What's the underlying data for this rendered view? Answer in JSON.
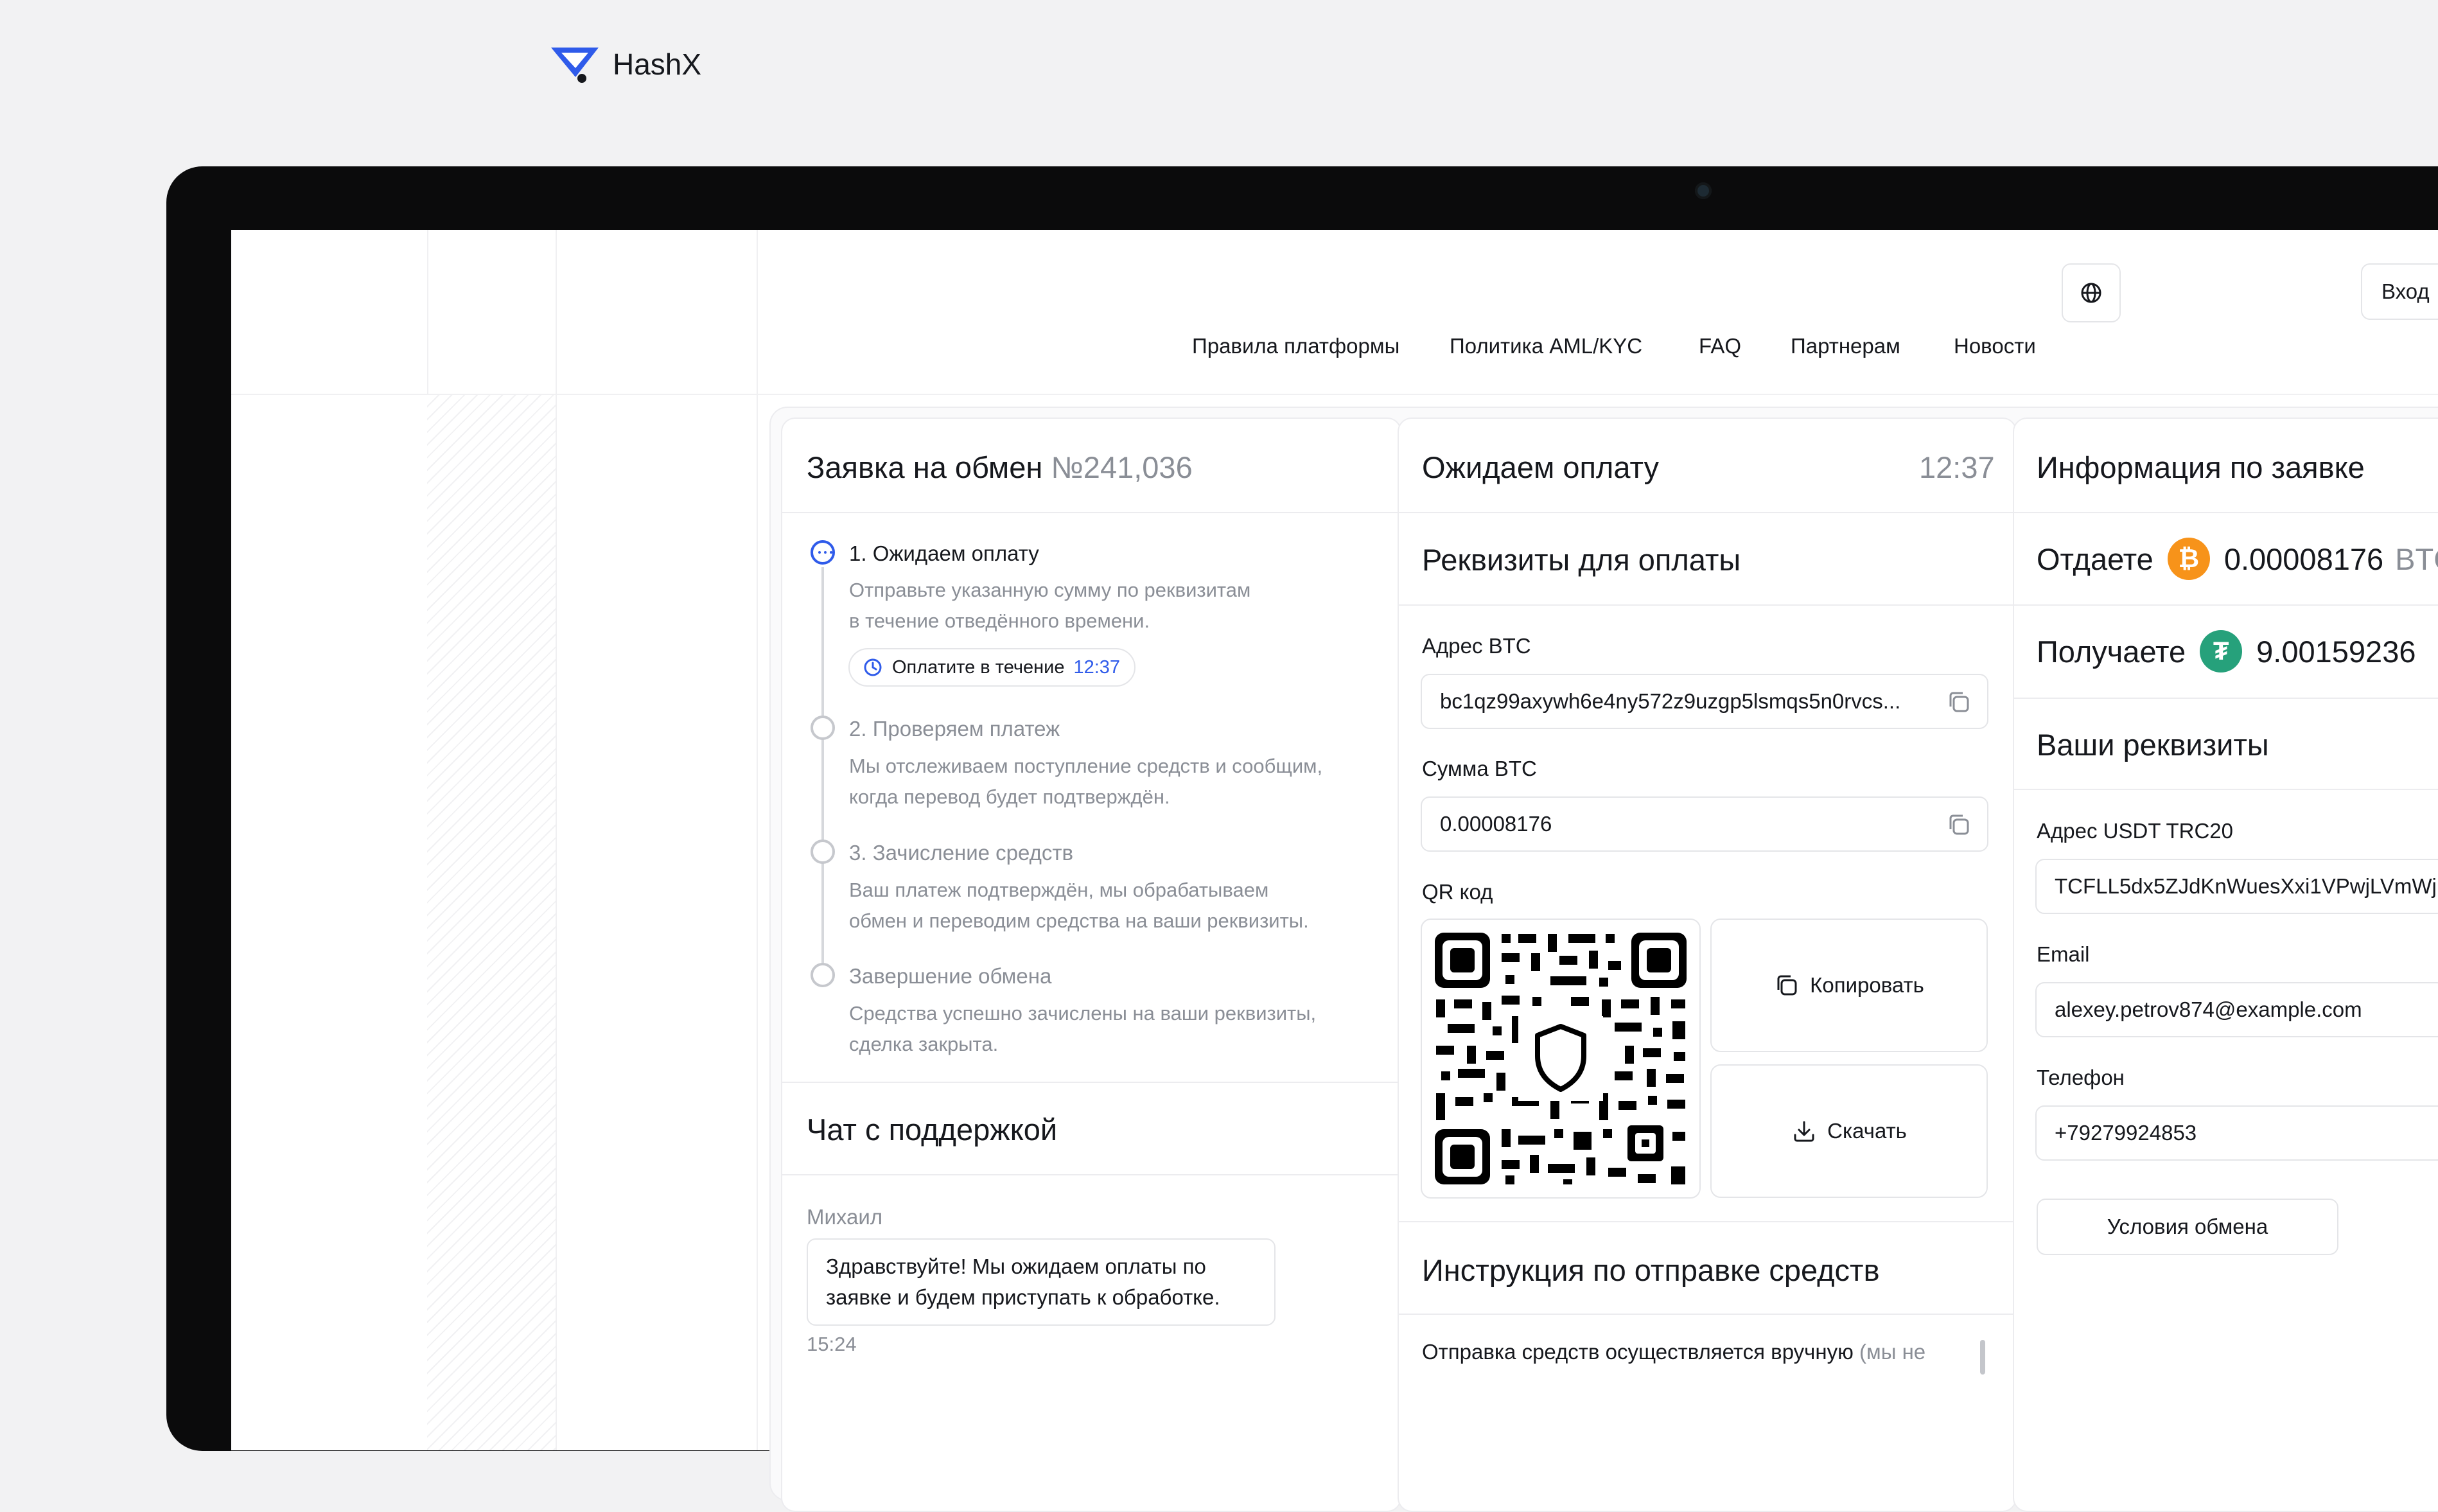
{
  "brand": {
    "name": "HashX"
  },
  "nav": [
    {
      "label": "Правила платформы"
    },
    {
      "label": "Политика AML/KYC"
    },
    {
      "label": "FAQ"
    },
    {
      "label": "Партнерам"
    },
    {
      "label": "Новости"
    }
  ],
  "header": {
    "login_label": "Вход"
  },
  "order": {
    "title": "Заявка на обмен",
    "number": "№241,036",
    "steps": [
      {
        "title": "1. Ожидаем оплату",
        "desc_line1": "Отправьте указанную сумму по реквизитам",
        "desc_line2": "в течение отведённого времени."
      },
      {
        "title": "2. Проверяем платеж",
        "desc_line1": "Мы отслеживаем поступление средств и сообщим,",
        "desc_line2": "когда перевод будет подтверждён."
      },
      {
        "title": "3. Зачисление средств",
        "desc_line1": "Ваш платеж подтверждён, мы обрабатываем",
        "desc_line2": "обмен и переводим средства на ваши реквизиты."
      },
      {
        "title": "Завершение обмена",
        "desc_line1": "Средства успешно зачислены на ваши реквизиты,",
        "desc_line2": "сделка закрыта."
      }
    ],
    "pay_pill": {
      "label": "Оплатите в течение",
      "time": "12:37"
    }
  },
  "chat": {
    "title": "Чат с поддержкой",
    "sender": "Михаил",
    "message_line1": "Здравствуйте! Мы ожидаем оплаты по",
    "message_line2": "заявке и будем приступать к обработке.",
    "time": "15:24"
  },
  "payment": {
    "title": "Ожидаем оплату",
    "timer": "12:37",
    "details_title": "Реквизиты для оплаты",
    "address_label": "Адрес BTC",
    "address_value": "bc1qz99axywh6e4ny572z9uzgp5lsmqs5n0rvcs...",
    "amount_label": "Сумма BTC",
    "amount_value": "0.00008176",
    "qr_label": "QR код",
    "copy_label": "Копировать",
    "download_label": "Скачать",
    "instructions_title": "Инструкция по отправке средств",
    "instructions_text": "Отправка средств осуществляется вручную",
    "instructions_muted": "(мы не"
  },
  "info": {
    "title": "Информация по заявке",
    "give_label": "Отдаете",
    "give_amount": "0.00008176",
    "give_unit": "BTC",
    "get_label": "Получаете",
    "get_amount": "9.00159236",
    "requisites_title": "Ваши реквизиты",
    "usdt_label": "Адрес USDT TRC20",
    "usdt_value": "TCFLL5dx5ZJdKnWuesXxi1VPwjLVmWj",
    "email_label": "Email",
    "email_value": "alexey.petrov874@example.com",
    "phone_label": "Телефон",
    "phone_value": "+79279924853",
    "conditions_label": "Условия обмена"
  },
  "colors": {
    "accent": "#2f5bea",
    "btc": "#f7931a",
    "usdt": "#26a17b",
    "border": "#e4e5e8",
    "muted": "#8a8e96"
  }
}
